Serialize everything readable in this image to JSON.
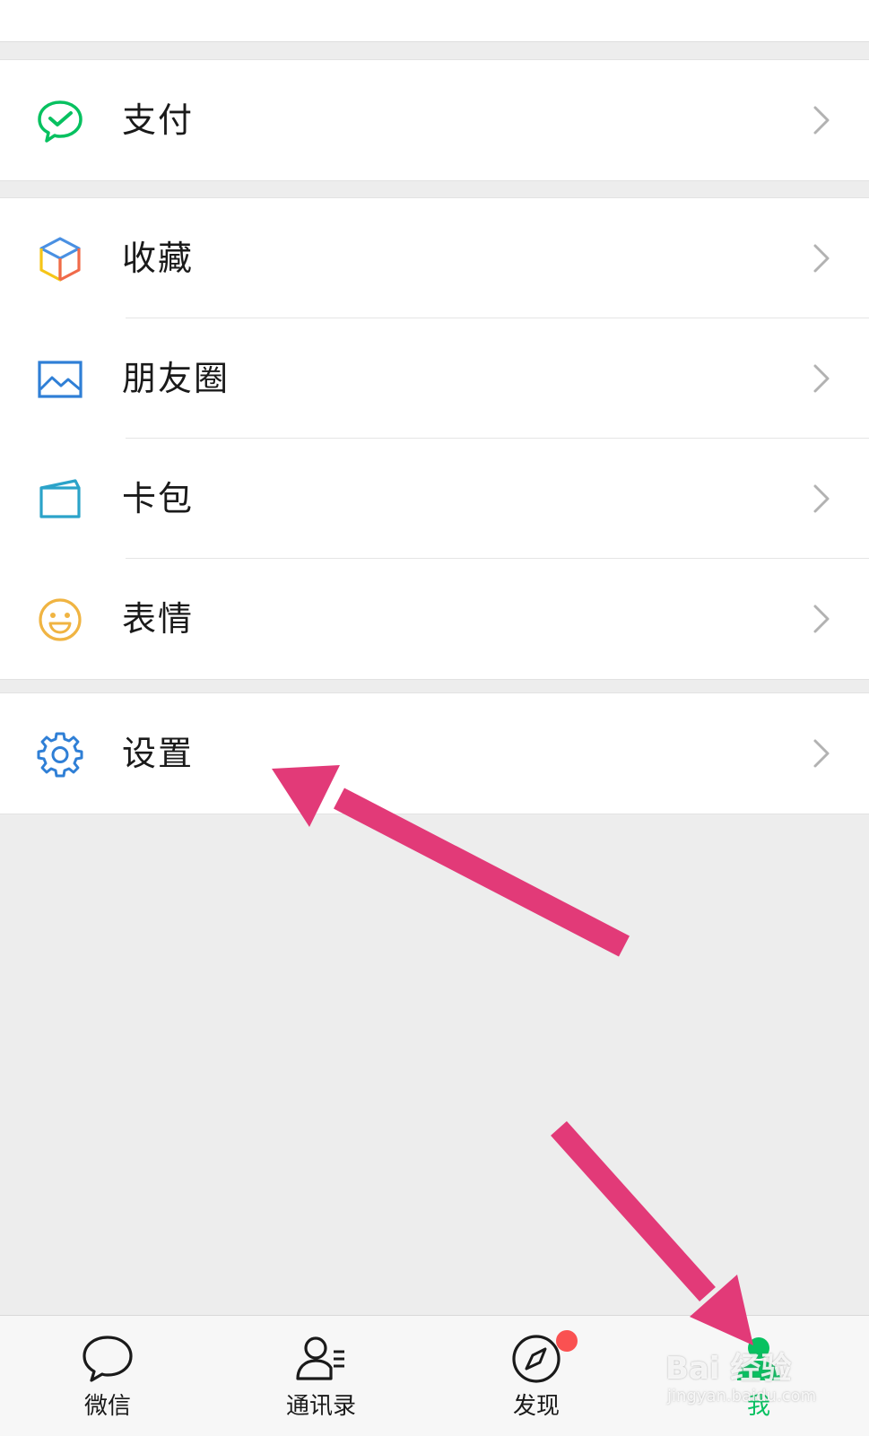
{
  "menu": {
    "pay": {
      "label": "支付",
      "icon": "wechat-pay-icon"
    },
    "favorites": {
      "label": "收藏",
      "icon": "cube-icon"
    },
    "moments": {
      "label": "朋友圈",
      "icon": "picture-icon"
    },
    "cards": {
      "label": "卡包",
      "icon": "card-wallet-icon"
    },
    "stickers": {
      "label": "表情",
      "icon": "smiley-icon"
    },
    "settings": {
      "label": "设置",
      "icon": "gear-icon"
    }
  },
  "tabbar": {
    "chats": {
      "label": "微信",
      "icon": "chat-bubble-icon"
    },
    "contacts": {
      "label": "通讯录",
      "icon": "contacts-icon"
    },
    "discover": {
      "label": "发现",
      "icon": "compass-icon",
      "has_red_dot": true
    },
    "me": {
      "label": "我",
      "icon": "person-icon",
      "active": true
    }
  },
  "watermark": {
    "brand": "Bai 经验",
    "url": "jingyan.baidu.com"
  },
  "colors": {
    "background": "#ededed",
    "cell": "#ffffff",
    "wechat_green": "#07c160",
    "annotation_arrow": "#e23a78",
    "badge_red": "#fa5151"
  }
}
